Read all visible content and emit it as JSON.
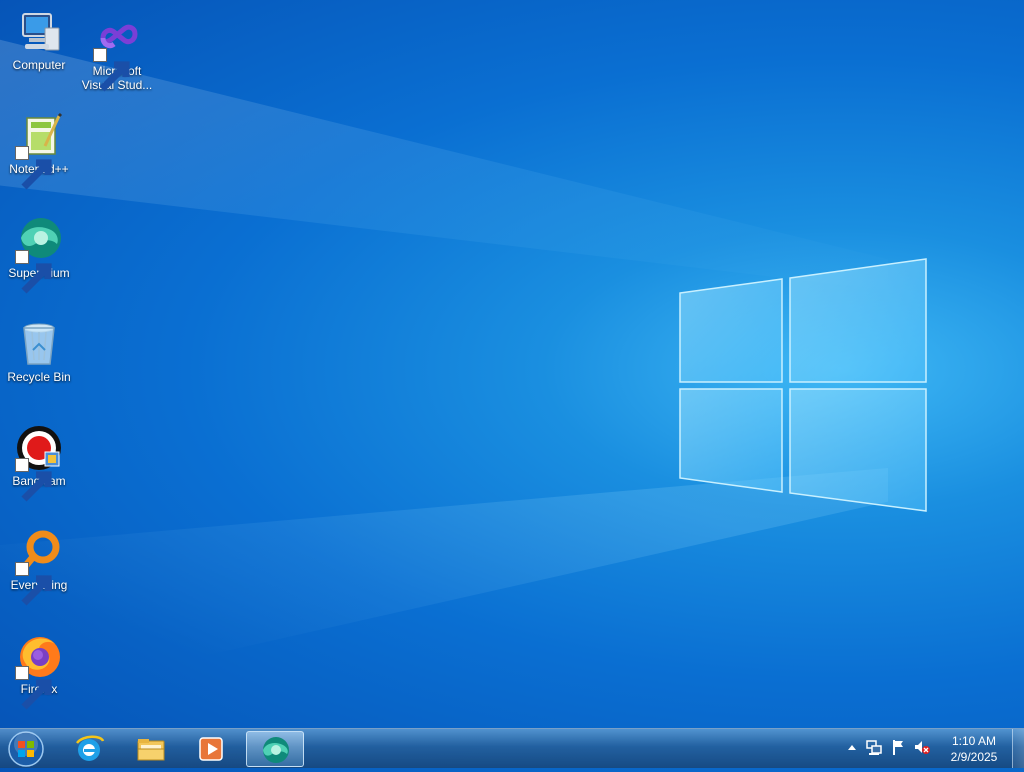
{
  "desktop": {
    "icons": [
      {
        "label": "Computer",
        "icon": "computer-icon",
        "shortcut": false
      },
      {
        "label": "Microsoft Visual Stud...",
        "icon": "visual-studio-icon",
        "shortcut": true
      },
      {
        "label": "Notepad++",
        "icon": "notepad-plus-plus-icon",
        "shortcut": true
      },
      {
        "label": "Supermium",
        "icon": "supermium-icon",
        "shortcut": true
      },
      {
        "label": "Recycle Bin",
        "icon": "recycle-bin-icon",
        "shortcut": false
      },
      {
        "label": "Bandicam",
        "icon": "bandicam-icon",
        "shortcut": true
      },
      {
        "label": "Everything",
        "icon": "everything-icon",
        "shortcut": true
      },
      {
        "label": "Firefox",
        "icon": "firefox-icon",
        "shortcut": true
      }
    ]
  },
  "taskbar": {
    "start": {
      "icon": "windows-start-orb-icon"
    },
    "pinned": [
      {
        "icon": "internet-explorer-icon",
        "active": false
      },
      {
        "icon": "file-explorer-icon",
        "active": false
      },
      {
        "icon": "media-player-icon",
        "active": false
      },
      {
        "icon": "supermium-icon",
        "active": true
      }
    ],
    "tray": {
      "icons": [
        "show-hidden-icons-chevron",
        "network-icon",
        "action-center-flag-icon",
        "volume-muted-icon"
      ],
      "time": "1:10 AM",
      "date": "2/9/2025"
    }
  },
  "colors": {
    "wallpaper_primary": "#0a6fd2",
    "wallpaper_light": "#3fb8f5",
    "taskbar": "#285f96"
  }
}
